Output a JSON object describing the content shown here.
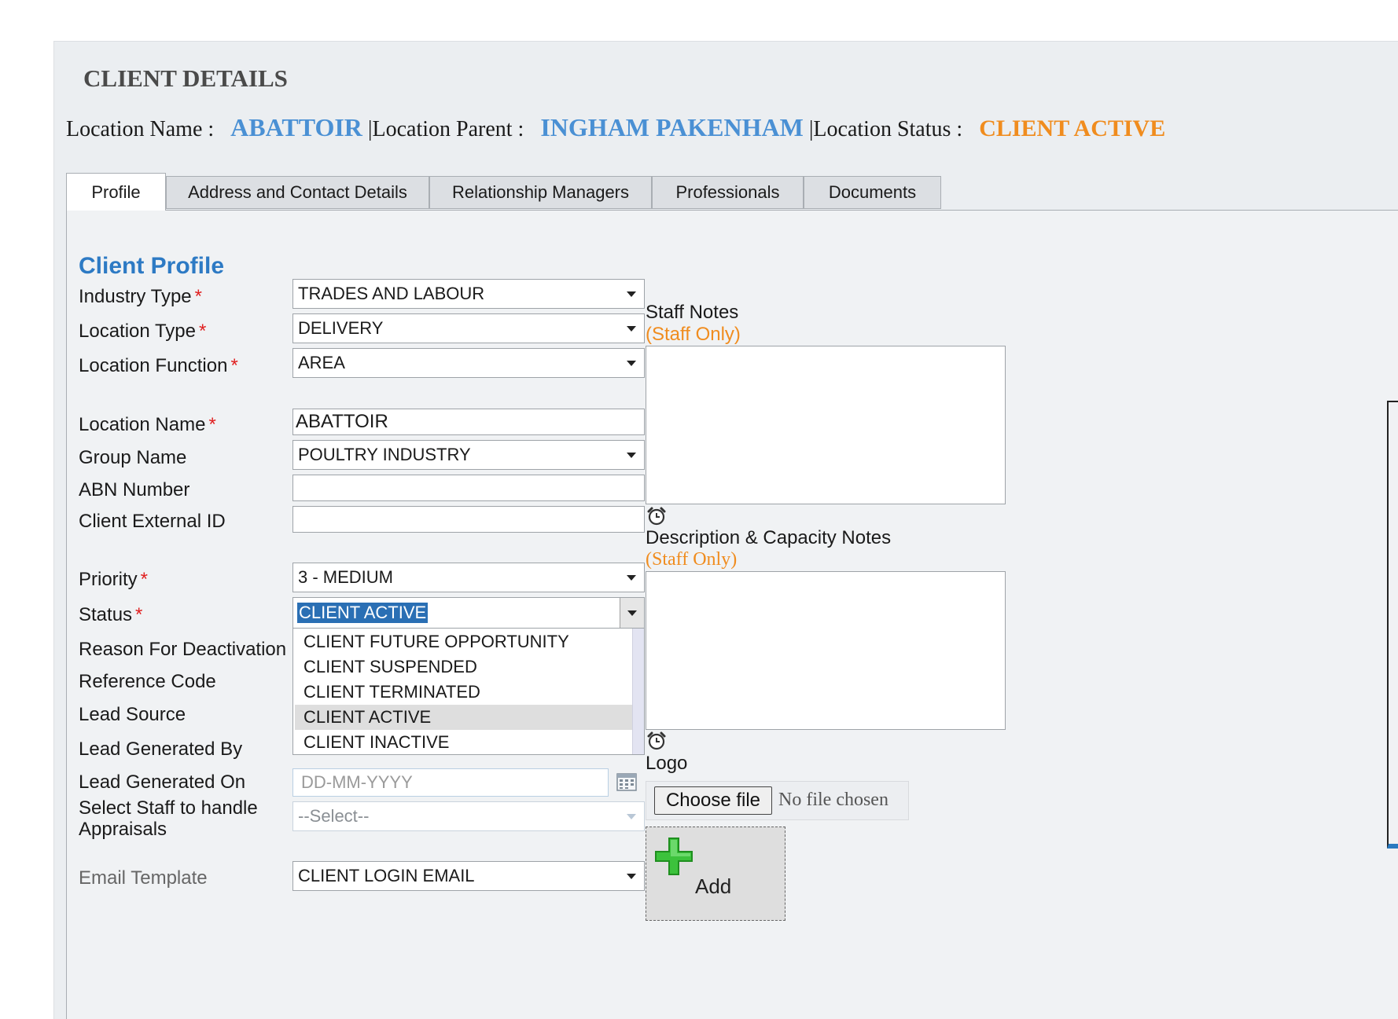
{
  "header": {
    "title": "CLIENT DETAILS",
    "location_name_label": "Location Name :",
    "location_name_value": "ABATTOIR",
    "location_parent_label": "|Location Parent :",
    "location_parent_value": "INGHAM PAKENHAM",
    "location_status_label": "|Location Status :",
    "location_status_value": "CLIENT ACTIVE"
  },
  "tabs": [
    {
      "label": "Profile",
      "active": true
    },
    {
      "label": "Address and Contact Details",
      "active": false
    },
    {
      "label": "Relationship Managers",
      "active": false
    },
    {
      "label": "Professionals",
      "active": false
    },
    {
      "label": "Documents",
      "active": false
    }
  ],
  "profile": {
    "section_title": "Client Profile",
    "required_mark": "*",
    "industry_type": {
      "label": "Industry Type",
      "value": "TRADES AND LABOUR"
    },
    "location_type": {
      "label": "Location Type",
      "value": "DELIVERY"
    },
    "location_function": {
      "label": "Location Function",
      "value": "AREA"
    },
    "location_name": {
      "label": "Location Name",
      "value": "ABATTOIR"
    },
    "group_name": {
      "label": "Group Name",
      "value": "POULTRY INDUSTRY"
    },
    "abn_number": {
      "label": "ABN Number",
      "value": ""
    },
    "client_external_id": {
      "label": "Client External ID",
      "value": ""
    },
    "priority": {
      "label": "Priority",
      "value": "3 - MEDIUM"
    },
    "status": {
      "label": "Status",
      "value": "CLIENT ACTIVE",
      "options": [
        "CLIENT FUTURE OPPORTUNITY",
        "CLIENT SUSPENDED",
        "CLIENT TERMINATED",
        "CLIENT ACTIVE",
        "CLIENT INACTIVE"
      ],
      "highlighted": "CLIENT ACTIVE"
    },
    "reason_for_deactivation": {
      "label": "Reason For Deactivation"
    },
    "reference_code": {
      "label": "Reference Code"
    },
    "lead_source": {
      "label": "Lead Source"
    },
    "lead_generated_by": {
      "label": "Lead Generated By"
    },
    "lead_generated_on": {
      "label": "Lead Generated On",
      "placeholder": "DD-MM-YYYY"
    },
    "select_staff": {
      "label_line1": "Select Staff to handle",
      "label_line2": "Appraisals",
      "value": "--Select--"
    },
    "email_template": {
      "label": "Email Template",
      "value": "CLIENT LOGIN EMAIL"
    }
  },
  "notes": {
    "staff_notes_label": "Staff Notes",
    "staff_only": "(Staff Only)",
    "description_label": "Description & Capacity Notes",
    "description_staff_only": "(Staff Only)"
  },
  "logo": {
    "label": "Logo",
    "choose_file": "Choose file",
    "no_file": "No file chosen",
    "add_label": "Add"
  },
  "icons": {
    "clock": "alarm-clock-icon",
    "calendar": "calendar-icon",
    "add": "green-plus-icon"
  },
  "colors": {
    "accent_blue": "#4a90d4",
    "section_blue": "#2d7ac4",
    "status_orange": "#f08c1e",
    "required_red": "#e02020",
    "selection_blue": "#2a6fb4"
  }
}
